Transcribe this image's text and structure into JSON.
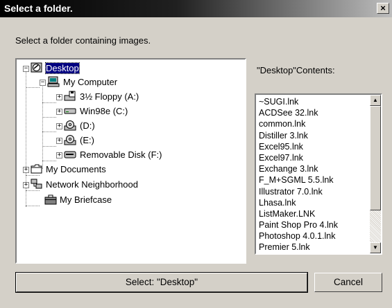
{
  "window": {
    "title": "Select a folder."
  },
  "instruction": "Select a folder containing images.",
  "contents_label": "\"Desktop\"Contents:",
  "tree": {
    "items": [
      {
        "label": "Desktop",
        "icon": "desktop-icon",
        "selected": true
      },
      {
        "label": "My Computer",
        "icon": "computer-icon"
      },
      {
        "label": "3½ Floppy (A:)",
        "icon": "floppy-drive-icon"
      },
      {
        "label": "Win98e (C:)",
        "icon": "hard-drive-icon"
      },
      {
        "label": "(D:)",
        "icon": "cd-drive-icon"
      },
      {
        "label": "(E:)",
        "icon": "cd-drive-icon"
      },
      {
        "label": "Removable Disk (F:)",
        "icon": "removable-disk-icon"
      },
      {
        "label": "My Documents",
        "icon": "folder-icon"
      },
      {
        "label": "Network Neighborhood",
        "icon": "network-icon"
      },
      {
        "label": "My Briefcase",
        "icon": "briefcase-icon"
      }
    ]
  },
  "contents": [
    "~SUGI.lnk",
    "ACDSee 32.lnk",
    "common.lnk",
    "Distiller 3.lnk",
    "Excel95.lnk",
    "Excel97.lnk",
    "Exchange 3.lnk",
    "F_M+SGML 5.5.lnk",
    "Illustrator 7.0.lnk",
    "Lhasa.lnk",
    "ListMaker.LNK",
    "Paint Shop Pro 4.lnk",
    "Photoshop 4.0.1.lnk",
    "Premier 5.lnk"
  ],
  "buttons": {
    "select": "Select: \"Desktop\"",
    "cancel": "Cancel",
    "close": "×"
  },
  "scroll": {
    "up": "▲",
    "down": "▼"
  },
  "expanders": {
    "expand": "+",
    "collapse": "−"
  }
}
